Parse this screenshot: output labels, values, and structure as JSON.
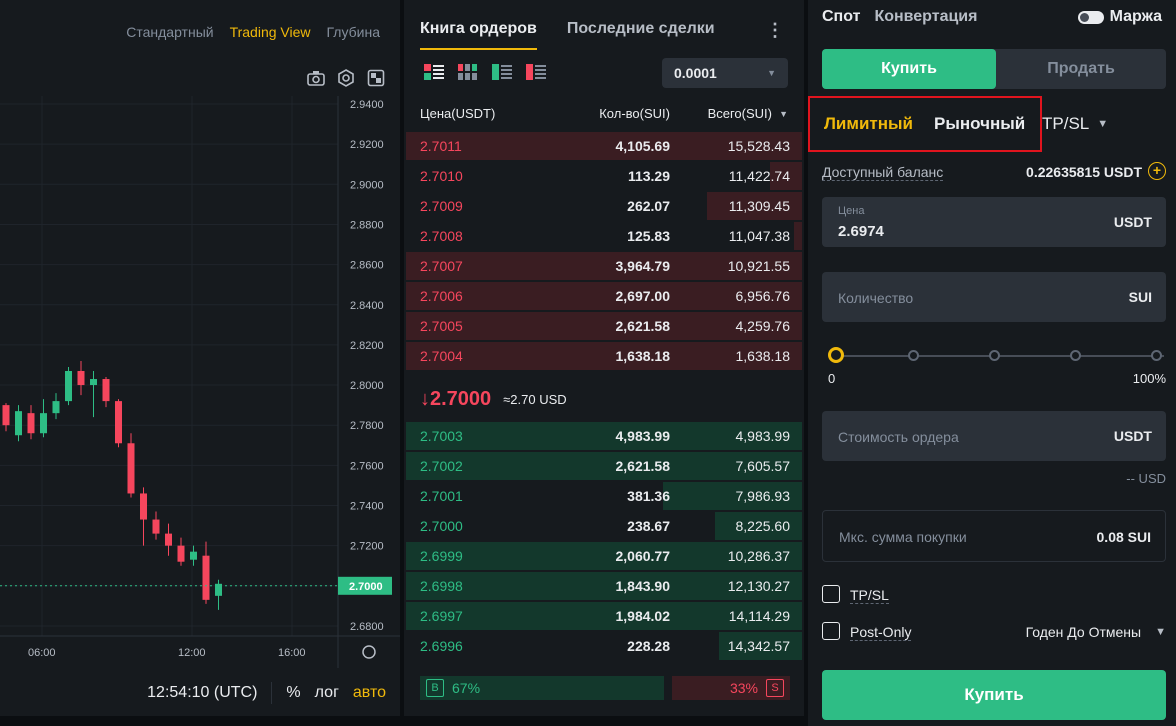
{
  "chart": {
    "tabs": [
      "Стандартный",
      "Trading View",
      "Глубина"
    ],
    "active_tab": "Trading View",
    "tool_icons": [
      "camera-icon",
      "settings-hex-icon",
      "fullscreen-icon"
    ],
    "price_axis": [
      "2.9400",
      "2.9200",
      "2.9000",
      "2.8800",
      "2.8600",
      "2.8400",
      "2.8200",
      "2.8000",
      "2.7800",
      "2.7600",
      "2.7400",
      "2.7200",
      "2.7000",
      "2.6800"
    ],
    "time_axis": [
      "06:00",
      "12:00",
      "16:00"
    ],
    "current_price_label": "2.7000",
    "colors": {
      "up": "#2ebd85",
      "down": "#f6465d"
    },
    "candles": [
      {
        "o": 2.79,
        "c": 2.78,
        "h": 2.791,
        "l": 2.777
      },
      {
        "o": 2.775,
        "c": 2.787,
        "h": 2.79,
        "l": 2.772
      },
      {
        "o": 2.786,
        "c": 2.776,
        "h": 2.79,
        "l": 2.773
      },
      {
        "o": 2.776,
        "c": 2.786,
        "h": 2.793,
        "l": 2.774
      },
      {
        "o": 2.786,
        "c": 2.792,
        "h": 2.796,
        "l": 2.783
      },
      {
        "o": 2.792,
        "c": 2.807,
        "h": 2.809,
        "l": 2.79
      },
      {
        "o": 2.807,
        "c": 2.8,
        "h": 2.812,
        "l": 2.795
      },
      {
        "o": 2.8,
        "c": 2.803,
        "h": 2.807,
        "l": 2.784
      },
      {
        "o": 2.803,
        "c": 2.792,
        "h": 2.804,
        "l": 2.789
      },
      {
        "o": 2.792,
        "c": 2.771,
        "h": 2.793,
        "l": 2.769
      },
      {
        "o": 2.771,
        "c": 2.746,
        "h": 2.776,
        "l": 2.744
      },
      {
        "o": 2.746,
        "c": 2.733,
        "h": 2.749,
        "l": 2.72
      },
      {
        "o": 2.733,
        "c": 2.726,
        "h": 2.737,
        "l": 2.723
      },
      {
        "o": 2.726,
        "c": 2.72,
        "h": 2.731,
        "l": 2.715
      },
      {
        "o": 2.72,
        "c": 2.712,
        "h": 2.724,
        "l": 2.71
      },
      {
        "o": 2.713,
        "c": 2.717,
        "h": 2.72,
        "l": 2.71
      },
      {
        "o": 2.715,
        "c": 2.693,
        "h": 2.722,
        "l": 2.691
      },
      {
        "o": 2.695,
        "c": 2.701,
        "h": 2.703,
        "l": 2.688
      }
    ],
    "bottom": {
      "time": "12:54:10 (UTC)",
      "percent": "%",
      "log": "лог",
      "auto": "авто"
    }
  },
  "orderbook": {
    "tabs": [
      "Книга ордеров",
      "Последние сделки"
    ],
    "active_tab": "Книга ордеров",
    "precision": "0.0001",
    "headers": {
      "price": "Цена(USDT)",
      "qty": "Кол-во(SUI)",
      "total": "Всего(SUI)"
    },
    "asks": [
      {
        "price": "2.7011",
        "qty": "4,105.69",
        "total": "15,528.43",
        "depth": 1.0
      },
      {
        "price": "2.7010",
        "qty": "113.29",
        "total": "11,422.74",
        "depth": 0.08
      },
      {
        "price": "2.7009",
        "qty": "262.07",
        "total": "11,309.45",
        "depth": 0.24
      },
      {
        "price": "2.7008",
        "qty": "125.83",
        "total": "11,047.38",
        "depth": 0.02
      },
      {
        "price": "2.7007",
        "qty": "3,964.79",
        "total": "10,921.55",
        "depth": 1.0
      },
      {
        "price": "2.7006",
        "qty": "2,697.00",
        "total": "6,956.76",
        "depth": 1.0
      },
      {
        "price": "2.7005",
        "qty": "2,621.58",
        "total": "4,259.76",
        "depth": 1.0
      },
      {
        "price": "2.7004",
        "qty": "1,638.18",
        "total": "1,638.18",
        "depth": 1.0
      }
    ],
    "last_price": "2.7000",
    "last_price_usd": "≈2.70 USD",
    "bids": [
      {
        "price": "2.7003",
        "qty": "4,983.99",
        "total": "4,983.99",
        "depth": 1.0
      },
      {
        "price": "2.7002",
        "qty": "2,621.58",
        "total": "7,605.57",
        "depth": 1.0
      },
      {
        "price": "2.7001",
        "qty": "381.36",
        "total": "7,986.93",
        "depth": 0.35
      },
      {
        "price": "2.7000",
        "qty": "238.67",
        "total": "8,225.60",
        "depth": 0.22
      },
      {
        "price": "2.6999",
        "qty": "2,060.77",
        "total": "10,286.37",
        "depth": 1.0
      },
      {
        "price": "2.6998",
        "qty": "1,843.90",
        "total": "12,130.27",
        "depth": 1.0
      },
      {
        "price": "2.6997",
        "qty": "1,984.02",
        "total": "14,114.29",
        "depth": 1.0
      },
      {
        "price": "2.6996",
        "qty": "228.28",
        "total": "14,342.57",
        "depth": 0.21
      }
    ],
    "ratio": {
      "buy_label": "B",
      "buy_percent": "67%",
      "sell_label": "S",
      "sell_percent": "33%",
      "buy_fraction": 0.67
    }
  },
  "trade": {
    "tabs": {
      "spot": "Спот",
      "convert": "Конвертация"
    },
    "margin_label": "Маржа",
    "buy_tab": "Купить",
    "sell_tab": "Продать",
    "order_types": {
      "limit": "Лимитный",
      "market": "Рыночный",
      "tpsl": "TP/SL"
    },
    "balance": {
      "label": "Доступный баланс",
      "value": "0.22635815 USDT"
    },
    "price_field": {
      "label": "Цена",
      "value": "2.6974",
      "unit": "USDT"
    },
    "qty_field": {
      "placeholder": "Количество",
      "unit": "SUI"
    },
    "slider": {
      "min": "0",
      "max": "100%",
      "value": 0
    },
    "total_field": {
      "placeholder": "Стоимость ордера",
      "unit": "USDT"
    },
    "usd_estimate": "-- USD",
    "max_buy": {
      "label": "Мкс. сумма покупки",
      "value": "0.08 SUI"
    },
    "tpsl_checkbox": "TP/SL",
    "postonly_checkbox": "Post-Only",
    "time_in_force": "Годен До Отмены",
    "submit": "Купить"
  }
}
